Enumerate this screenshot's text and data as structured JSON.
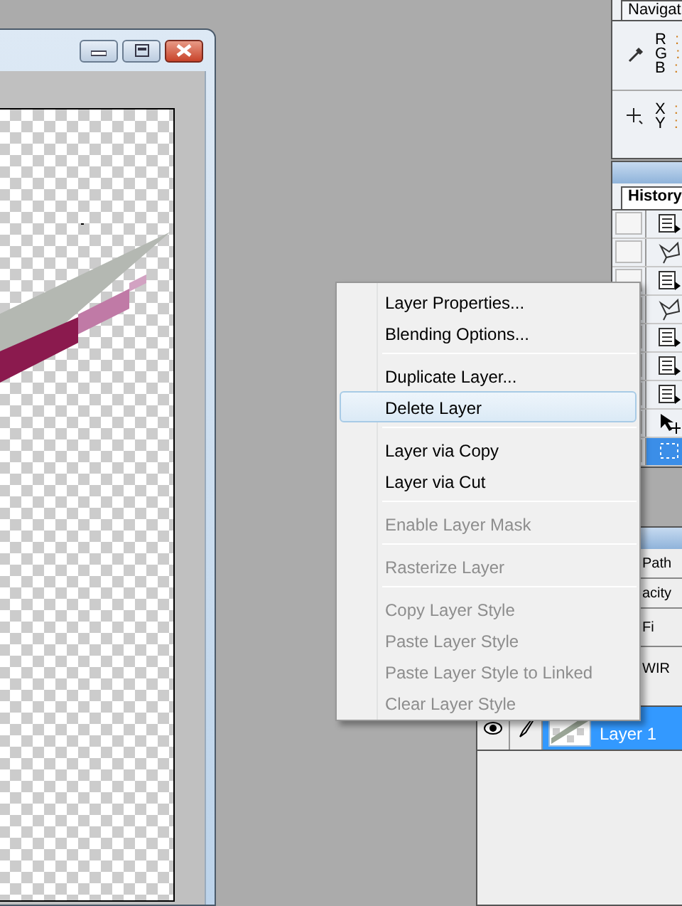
{
  "document_window": {
    "buttons": [
      {
        "kind": "minimize"
      },
      {
        "kind": "maximize"
      },
      {
        "kind": "close"
      }
    ]
  },
  "navigator_panel": {
    "tab": "Navigat",
    "color_readouts": [
      {
        "label": "R",
        "separator": ":"
      },
      {
        "label": "G",
        "separator": ":"
      },
      {
        "label": "B",
        "separator": ":"
      }
    ],
    "position_readouts": [
      {
        "label": "X",
        "separator": ":"
      },
      {
        "label": "Y",
        "separator": ":"
      }
    ]
  },
  "history_panel": {
    "tab": "History",
    "rows": [
      {
        "kind": "document",
        "selected": false
      },
      {
        "kind": "lasso",
        "selected": false
      },
      {
        "kind": "document",
        "selected": false
      },
      {
        "kind": "lasso",
        "selected": false
      },
      {
        "kind": "document",
        "selected": false
      },
      {
        "kind": "document",
        "selected": false
      },
      {
        "kind": "document",
        "selected": false
      },
      {
        "kind": "move",
        "selected": false
      },
      {
        "kind": "marquee",
        "selected": true
      }
    ]
  },
  "layers_panel": {
    "tab_fragment": "Path",
    "opacity_fragment": "acity",
    "fill_fragment": "Fi",
    "group_fragment": "WIR",
    "layers": [
      {
        "name": "Layer 1",
        "visible": true,
        "selected": true
      }
    ]
  },
  "context_menu": {
    "groups": [
      [
        {
          "label": "Layer Properties...",
          "disabled": false,
          "highlighted": false
        },
        {
          "label": "Blending Options...",
          "disabled": false,
          "highlighted": false
        }
      ],
      [
        {
          "label": "Duplicate Layer...",
          "disabled": false,
          "highlighted": false
        },
        {
          "label": "Delete Layer",
          "disabled": false,
          "highlighted": true
        }
      ],
      [
        {
          "label": "Layer via Copy",
          "disabled": false,
          "highlighted": false
        },
        {
          "label": "Layer via Cut",
          "disabled": false,
          "highlighted": false
        }
      ],
      [
        {
          "label": "Enable Layer Mask",
          "disabled": true,
          "highlighted": false
        }
      ],
      [
        {
          "label": "Rasterize Layer",
          "disabled": true,
          "highlighted": false
        }
      ],
      [
        {
          "label": "Copy Layer Style",
          "disabled": true,
          "highlighted": false
        },
        {
          "label": "Paste Layer Style",
          "disabled": true,
          "highlighted": false
        },
        {
          "label": "Paste Layer Style to Linked",
          "disabled": true,
          "highlighted": false
        },
        {
          "label": "Clear Layer Style",
          "disabled": true,
          "highlighted": false
        }
      ]
    ]
  }
}
